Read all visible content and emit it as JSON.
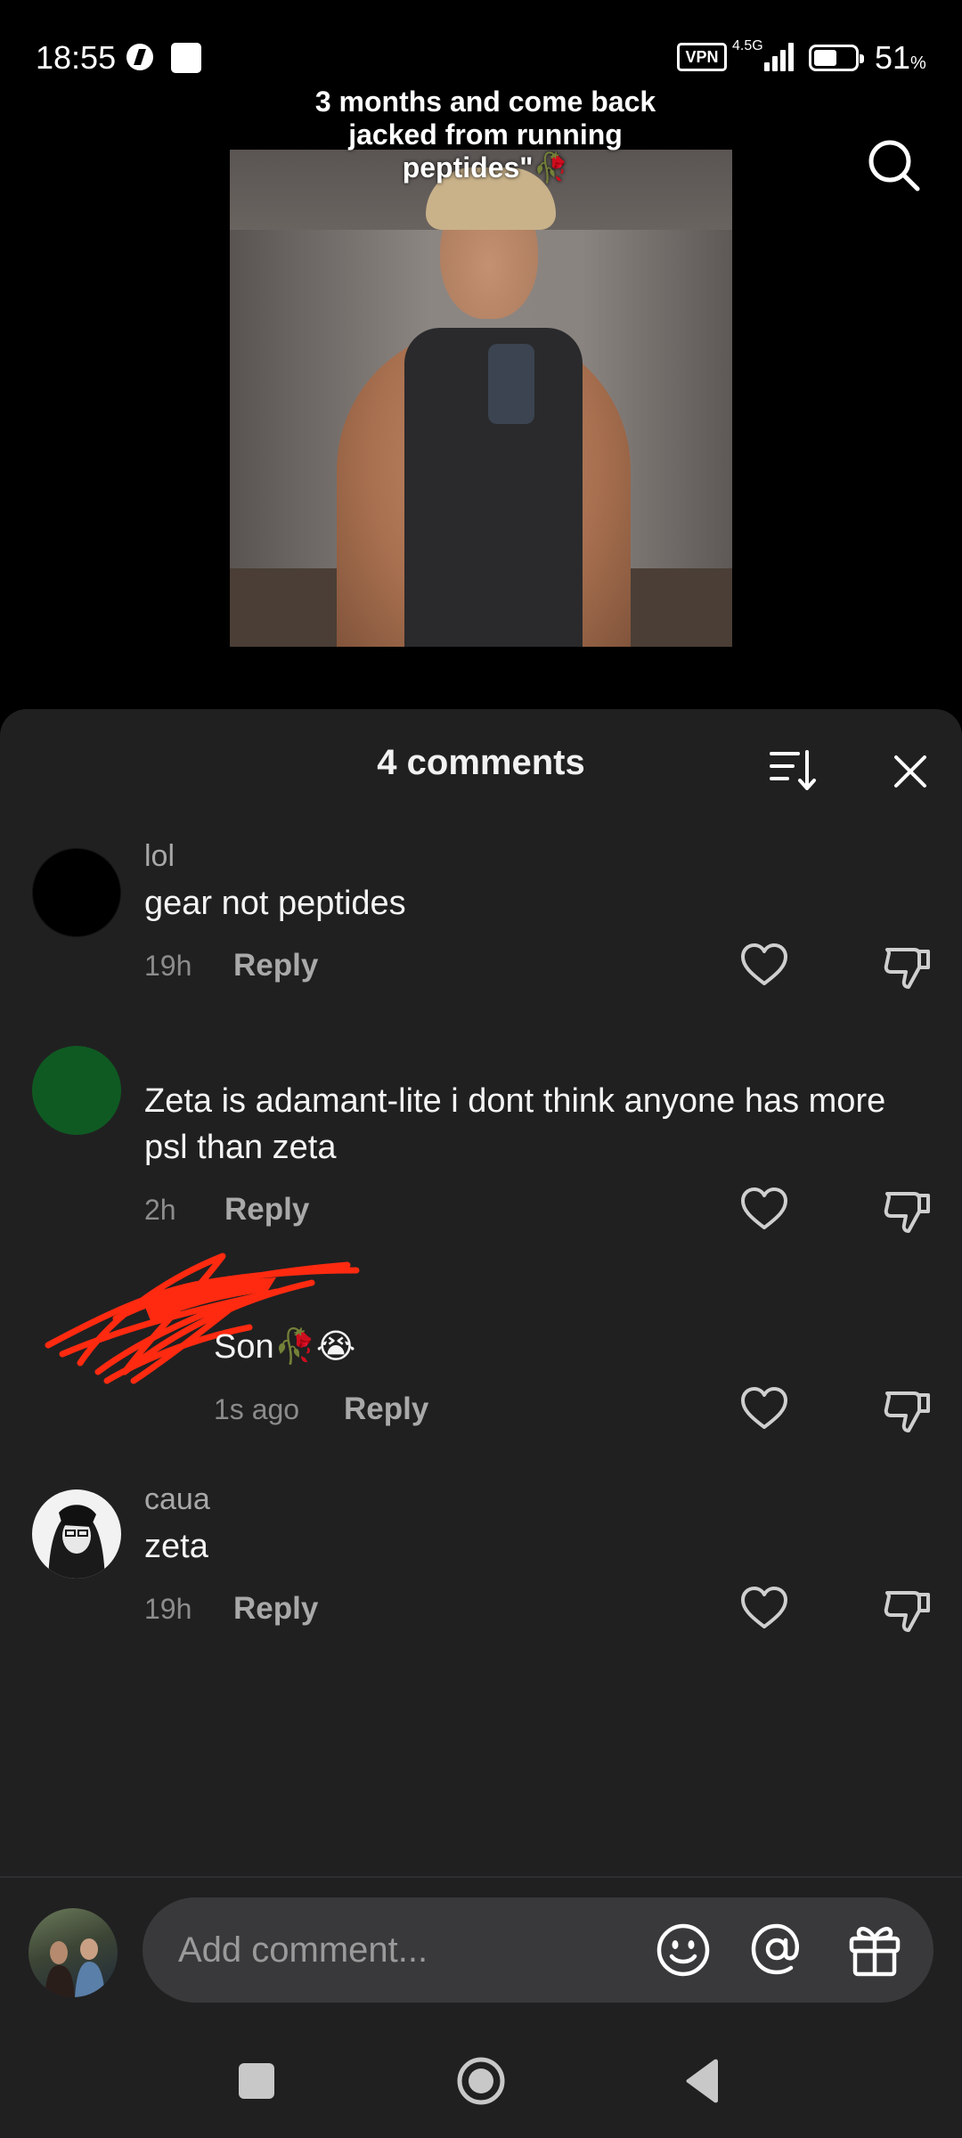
{
  "status_bar": {
    "time": "18:55",
    "vpn": "VPN",
    "network": "4.5G",
    "battery_level": "51",
    "battery_unit": "%"
  },
  "video": {
    "caption": "3 months and come back jacked from running peptides\"🥀"
  },
  "sheet": {
    "title": "4 comments"
  },
  "comments": [
    {
      "user": "lol",
      "text": "gear not peptides",
      "time": "19h",
      "reply": "Reply",
      "avatar_color": "#000000"
    },
    {
      "user": "",
      "text": "Zeta is adamant-lite i dont think anyone has more psl than zeta",
      "time": "2h",
      "reply": "Reply",
      "avatar_color": "#0f5a22"
    },
    {
      "user": "",
      "text": "Son🥀😭",
      "time": "1s ago",
      "reply": "Reply"
    },
    {
      "user": "caua",
      "text": "zeta",
      "time": "19h",
      "reply": "Reply"
    }
  ],
  "composer": {
    "placeholder": "Add comment..."
  },
  "colors": {
    "sheet_bg": "#202021",
    "input_bg": "#39393b",
    "scribble": "#ff2a10"
  },
  "icons": [
    "search-icon",
    "sort-icon",
    "close-icon",
    "heart-icon",
    "dislike-icon",
    "emoji-icon",
    "at-icon",
    "gift-icon",
    "nav-recent-icon",
    "nav-home-icon",
    "nav-back-icon"
  ]
}
